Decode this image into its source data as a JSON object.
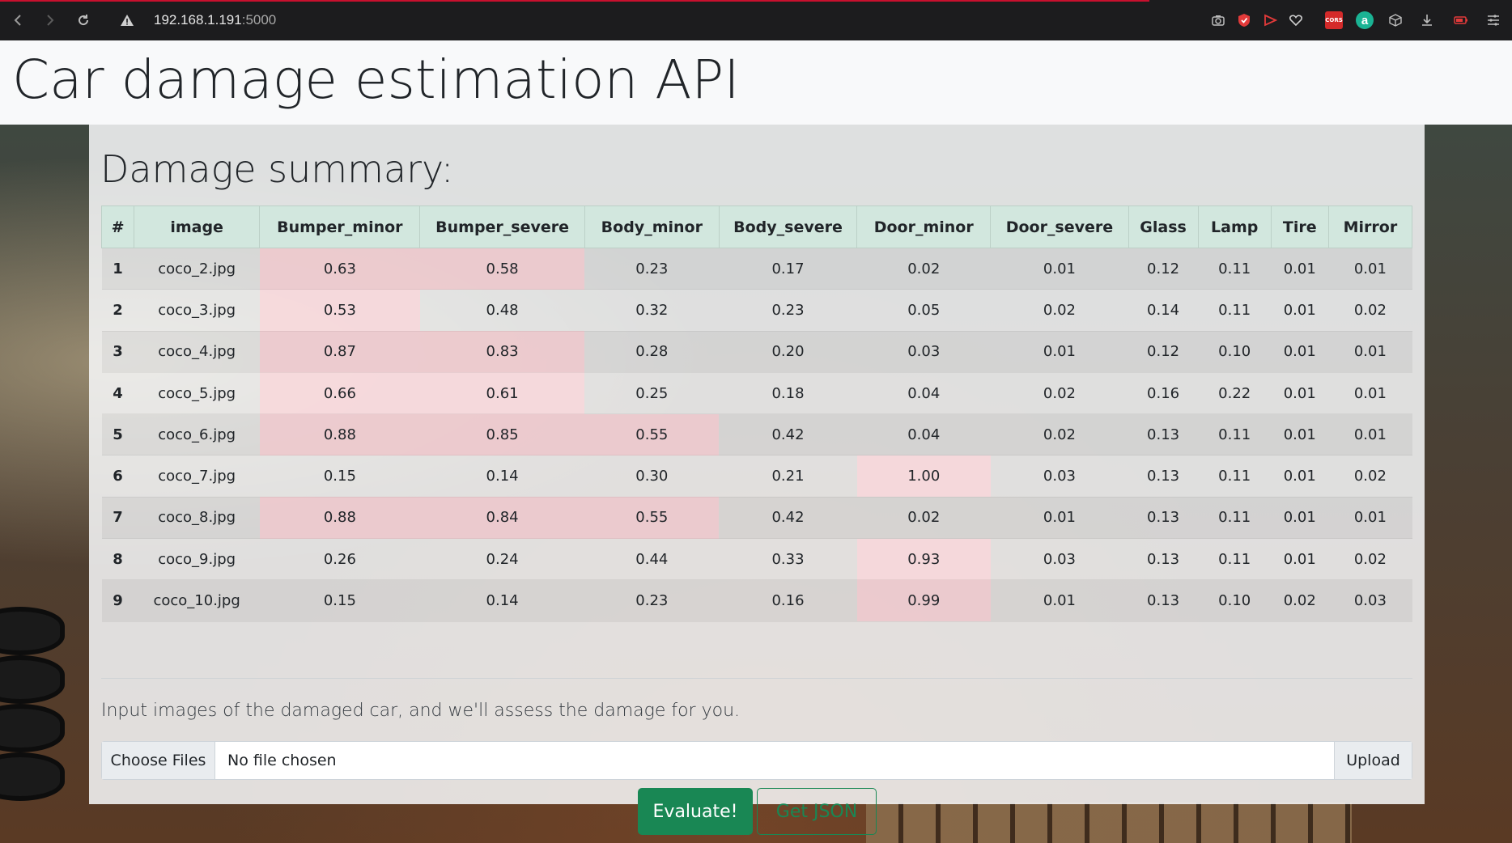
{
  "browser": {
    "url_host": "192.168.1.191",
    "url_port": ":5000",
    "extensions": [
      "camera-icon",
      "shield-icon",
      "play-icon",
      "heart-icon",
      "cors-icon",
      "a-icon",
      "cube-icon",
      "download-icon",
      "battery-icon",
      "menu-icon"
    ],
    "cors_label": "CORS",
    "a_label": "a"
  },
  "header": {
    "title": "Car damage estimation API"
  },
  "summary": {
    "heading": "Damage summary:",
    "columns": [
      "#",
      "image",
      "Bumper_minor",
      "Bumper_severe",
      "Body_minor",
      "Body_severe",
      "Door_minor",
      "Door_severe",
      "Glass",
      "Lamp",
      "Tire",
      "Mirror"
    ],
    "rows": [
      [
        "1",
        "coco_2.jpg",
        "0.63",
        "0.58",
        "0.23",
        "0.17",
        "0.02",
        "0.01",
        "0.12",
        "0.11",
        "0.01",
        "0.01"
      ],
      [
        "2",
        "coco_3.jpg",
        "0.53",
        "0.48",
        "0.32",
        "0.23",
        "0.05",
        "0.02",
        "0.14",
        "0.11",
        "0.01",
        "0.02"
      ],
      [
        "3",
        "coco_4.jpg",
        "0.87",
        "0.83",
        "0.28",
        "0.20",
        "0.03",
        "0.01",
        "0.12",
        "0.10",
        "0.01",
        "0.01"
      ],
      [
        "4",
        "coco_5.jpg",
        "0.66",
        "0.61",
        "0.25",
        "0.18",
        "0.04",
        "0.02",
        "0.16",
        "0.22",
        "0.01",
        "0.01"
      ],
      [
        "5",
        "coco_6.jpg",
        "0.88",
        "0.85",
        "0.55",
        "0.42",
        "0.04",
        "0.02",
        "0.13",
        "0.11",
        "0.01",
        "0.01"
      ],
      [
        "6",
        "coco_7.jpg",
        "0.15",
        "0.14",
        "0.30",
        "0.21",
        "1.00",
        "0.03",
        "0.13",
        "0.11",
        "0.01",
        "0.02"
      ],
      [
        "7",
        "coco_8.jpg",
        "0.88",
        "0.84",
        "0.55",
        "0.42",
        "0.02",
        "0.01",
        "0.13",
        "0.11",
        "0.01",
        "0.01"
      ],
      [
        "8",
        "coco_9.jpg",
        "0.26",
        "0.24",
        "0.44",
        "0.33",
        "0.93",
        "0.03",
        "0.13",
        "0.11",
        "0.01",
        "0.02"
      ],
      [
        "9",
        "coco_10.jpg",
        "0.15",
        "0.14",
        "0.23",
        "0.16",
        "0.99",
        "0.01",
        "0.13",
        "0.10",
        "0.02",
        "0.03"
      ]
    ],
    "highlight_threshold": 0.5,
    "highlight_color": "#f8d7da"
  },
  "form": {
    "lead": "Input images of the damaged car, and we'll assess the damage for you.",
    "choose_label": "Choose Files",
    "file_status": "No file chosen",
    "upload_label": "Upload",
    "evaluate_label": "Evaluate!",
    "json_label": "Get JSON",
    "accent": "#198754"
  }
}
